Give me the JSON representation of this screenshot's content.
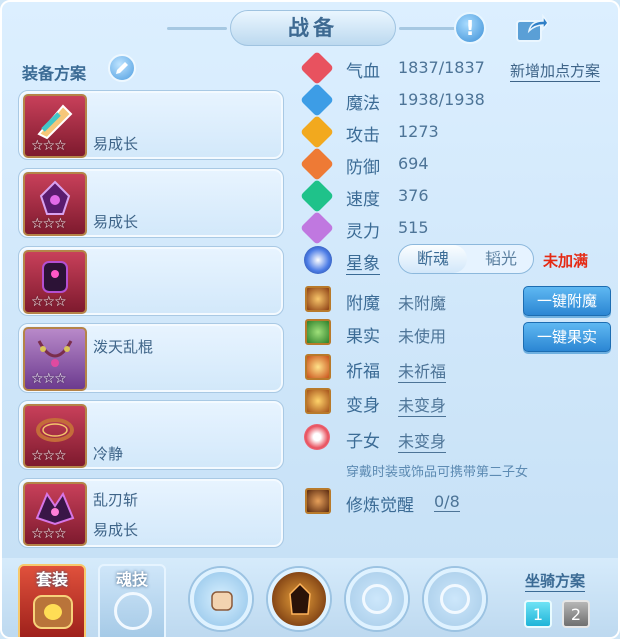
{
  "window": {
    "title": "战备"
  },
  "scheme": {
    "label": "装备方案"
  },
  "slots": [
    {
      "name": "",
      "sub": "易成长",
      "stars": "☆☆☆"
    },
    {
      "name": "",
      "sub": "易成长",
      "stars": "☆☆☆"
    },
    {
      "name": "",
      "sub": "",
      "stars": "☆☆☆"
    },
    {
      "name": "泼天乱棍",
      "sub": "",
      "stars": "☆☆☆"
    },
    {
      "name": "",
      "sub": "冷静",
      "stars": "☆☆☆"
    },
    {
      "name": "乱刃斩",
      "sub": "易成长",
      "stars": "☆☆☆"
    }
  ],
  "stats": [
    {
      "label": "气血",
      "value": "1837/1837",
      "color": "#e8525f"
    },
    {
      "label": "魔法",
      "value": "1938/1938",
      "color": "#3d9de6"
    },
    {
      "label": "攻击",
      "value": "1273",
      "color": "#f2a91e"
    },
    {
      "label": "防御",
      "value": "694",
      "color": "#ee7a35"
    },
    {
      "label": "速度",
      "value": "376",
      "color": "#1fc28a"
    },
    {
      "label": "灵力",
      "value": "515",
      "color": "#c078e0"
    }
  ],
  "add_point_scheme": "新增加点方案",
  "star": {
    "label": "星象",
    "opt1": "断魂",
    "opt2": "韬光",
    "status": "未加满"
  },
  "enchant": {
    "label": "附魔",
    "value": "未附魔",
    "button": "一键附魔"
  },
  "fruit": {
    "label": "果实",
    "value": "未使用",
    "button": "一键果实"
  },
  "blessing": {
    "label": "祈福",
    "value": "未祈福"
  },
  "transform": {
    "label": "变身",
    "value": "未变身"
  },
  "child": {
    "label": "子女",
    "value": "未变身"
  },
  "note": "穿戴时装或饰品可携带第二子女",
  "awaken": {
    "label": "修炼觉醒",
    "value": "0/8"
  },
  "bottom": {
    "tab1": "套装",
    "tab2": "魂技",
    "mount_label": "坐骑方案",
    "mount1": "1",
    "mount2": "2"
  }
}
